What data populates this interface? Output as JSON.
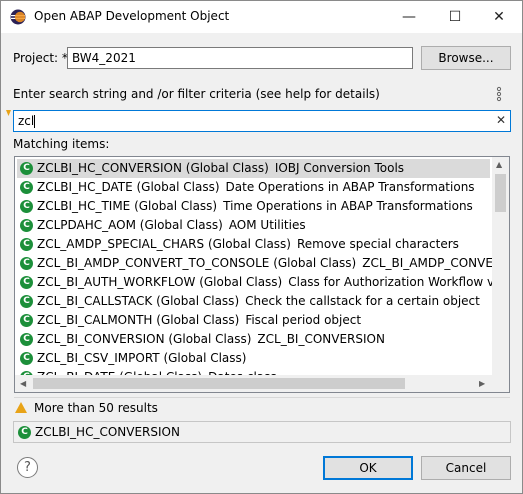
{
  "window": {
    "title": "Open ABAP Development Object",
    "minimize_glyph": "—",
    "maximize_glyph": "☐",
    "close_glyph": "✕"
  },
  "project": {
    "label": "Project: *",
    "value": "BW4_2021",
    "browse_label": "Browse..."
  },
  "search": {
    "instruction": "Enter search string and /or filter criteria (see help for details)",
    "value": "zcl",
    "clear_glyph": "✕"
  },
  "matching": {
    "label": "Matching items:",
    "items": [
      {
        "name": "ZCLBI_HC_CONVERSION (Global Class)",
        "desc": "IOBJ Conversion Tools",
        "selected": true
      },
      {
        "name": "ZCLBI_HC_DATE (Global Class)",
        "desc": "Date Operations in ABAP Transformations",
        "selected": false
      },
      {
        "name": "ZCLBI_HC_TIME (Global Class)",
        "desc": "Time Operations in ABAP Transformations",
        "selected": false
      },
      {
        "name": "ZCLPDAHC_AOM (Global Class)",
        "desc": "AOM Utilities",
        "selected": false
      },
      {
        "name": "ZCL_AMDP_SPECIAL_CHARS (Global Class)",
        "desc": "Remove special characters",
        "selected": false
      },
      {
        "name": "ZCL_BI_AMDP_CONVERT_TO_CONSOLE (Global Class)",
        "desc": "ZCL_BI_AMDP_CONVERT_TO_C",
        "selected": false
      },
      {
        "name": "ZCL_BI_AUTH_WORKFLOW (Global Class)",
        "desc": "Class for Authorization Workflow via Cherw",
        "selected": false
      },
      {
        "name": "ZCL_BI_CALLSTACK (Global Class)",
        "desc": "Check the callstack for a certain object",
        "selected": false
      },
      {
        "name": "ZCL_BI_CALMONTH (Global Class)",
        "desc": "Fiscal period object",
        "selected": false
      },
      {
        "name": "ZCL_BI_CONVERSION (Global Class)",
        "desc": "ZCL_BI_CONVERSION",
        "selected": false
      },
      {
        "name": "ZCL_BI_CSV_IMPORT (Global Class)",
        "desc": "",
        "selected": false
      },
      {
        "name": "ZCL_BI_DATE (Global Class)",
        "desc": "Dates class",
        "selected": false
      }
    ]
  },
  "status": {
    "message": "More than 50 results",
    "selected_item": "ZCLBI_HC_CONVERSION"
  },
  "buttons": {
    "help_glyph": "?",
    "ok": "OK",
    "cancel": "Cancel"
  },
  "colors": {
    "class_icon": "#1c8f3a",
    "warning": "#e8a317",
    "default_button_border": "#0078d7",
    "selected_row": "#dadada"
  },
  "icons": {
    "class_glyph": "C"
  }
}
